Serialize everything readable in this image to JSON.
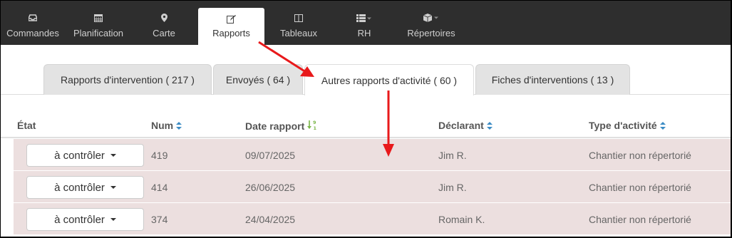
{
  "nav": {
    "items": [
      {
        "label": "Commandes",
        "icon": "inbox-icon"
      },
      {
        "label": "Planification",
        "icon": "calendar-icon"
      },
      {
        "label": "Carte",
        "icon": "map-marker-icon"
      },
      {
        "label": "Rapports",
        "icon": "edit-icon",
        "active": true
      },
      {
        "label": "Tableaux",
        "icon": "columns-icon"
      },
      {
        "label": "RH",
        "icon": "list-icon"
      },
      {
        "label": "Répertoires",
        "icon": "cube-icon"
      }
    ]
  },
  "tabs": [
    {
      "label": "Rapports d'intervention ( 217 )"
    },
    {
      "label": "Envoyés ( 64 )"
    },
    {
      "label": "Autres rapports d'activité ( 60 )",
      "active": true
    },
    {
      "label": "Fiches d'interventions ( 13 )"
    }
  ],
  "table": {
    "headers": {
      "etat": "État",
      "num": "Num",
      "date": "Date rapport",
      "declarant": "Déclarant",
      "type": "Type d'activité"
    },
    "rows": [
      {
        "state": "à contrôler",
        "num": "419",
        "date": "09/07/2025",
        "declarant": "Jim R.",
        "type": "Chantier non répertorié"
      },
      {
        "state": "à contrôler",
        "num": "414",
        "date": "26/06/2025",
        "declarant": "Jim R.",
        "type": "Chantier non répertorié"
      },
      {
        "state": "à contrôler",
        "num": "374",
        "date": "24/04/2025",
        "declarant": "Romain K.",
        "type": "Chantier non répertorié"
      }
    ]
  },
  "colors": {
    "nav_bg": "#2e2e2e",
    "row_bg": "#ecdfdf",
    "sort_icon": "#3b8bc4",
    "sort_active": "#7ab648",
    "annotation_arrow": "#e8191b"
  }
}
